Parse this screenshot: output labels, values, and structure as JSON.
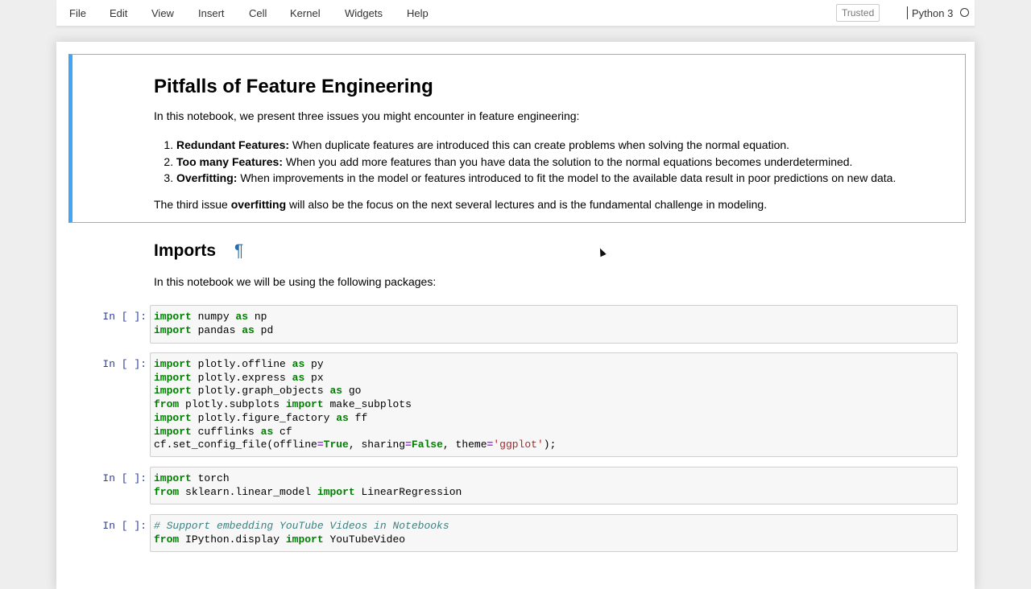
{
  "menubar": {
    "items": [
      "File",
      "Edit",
      "View",
      "Insert",
      "Cell",
      "Kernel",
      "Widgets",
      "Help"
    ],
    "trusted_label": "Trusted",
    "kernel_name": "Python 3"
  },
  "intro": {
    "title": "Pitfalls of Feature Engineering",
    "lead": "In this notebook, we present three issues you might encounter in feature engineering:",
    "issues": [
      {
        "term": "Redundant Features:",
        "text": " When duplicate features are introduced this can create problems when solving the normal equation."
      },
      {
        "term": "Too many Features:",
        "text": " When you add more features than you have data the solution to the normal equations becomes underdetermined."
      },
      {
        "term": "Overfitting:",
        "text": " When improvements in the model or features introduced to fit the model to the available data result in poor predictions on new data."
      }
    ],
    "closing_pre": "The third issue ",
    "closing_bold": "overfitting",
    "closing_post": " will also be the focus on the next several lectures and is the fundamental challenge in modeling."
  },
  "imports": {
    "heading": "Imports",
    "anchor": "¶",
    "subtitle": "In this notebook we will be using the following packages:"
  },
  "cells": [
    {
      "prompt": "In [ ]:",
      "lines": [
        [
          {
            "t": "import",
            "c": "kw"
          },
          {
            "t": " numpy ",
            "c": ""
          },
          {
            "t": "as",
            "c": "kw"
          },
          {
            "t": " np",
            "c": ""
          }
        ],
        [
          {
            "t": "import",
            "c": "kw"
          },
          {
            "t": " pandas ",
            "c": ""
          },
          {
            "t": "as",
            "c": "kw"
          },
          {
            "t": " pd",
            "c": ""
          }
        ]
      ]
    },
    {
      "prompt": "In [ ]:",
      "lines": [
        [
          {
            "t": "import",
            "c": "kw"
          },
          {
            "t": " plotly.offline ",
            "c": ""
          },
          {
            "t": "as",
            "c": "kw"
          },
          {
            "t": " py",
            "c": ""
          }
        ],
        [
          {
            "t": "import",
            "c": "kw"
          },
          {
            "t": " plotly.express ",
            "c": ""
          },
          {
            "t": "as",
            "c": "kw"
          },
          {
            "t": " px",
            "c": ""
          }
        ],
        [
          {
            "t": "import",
            "c": "kw"
          },
          {
            "t": " plotly.graph_objects ",
            "c": ""
          },
          {
            "t": "as",
            "c": "kw"
          },
          {
            "t": " go",
            "c": ""
          }
        ],
        [
          {
            "t": "from",
            "c": "kw"
          },
          {
            "t": " plotly.subplots ",
            "c": ""
          },
          {
            "t": "import",
            "c": "kw"
          },
          {
            "t": " make_subplots",
            "c": ""
          }
        ],
        [
          {
            "t": "import",
            "c": "kw"
          },
          {
            "t": " plotly.figure_factory ",
            "c": ""
          },
          {
            "t": "as",
            "c": "kw"
          },
          {
            "t": " ff",
            "c": ""
          }
        ],
        [
          {
            "t": "import",
            "c": "kw"
          },
          {
            "t": " cufflinks ",
            "c": ""
          },
          {
            "t": "as",
            "c": "kw"
          },
          {
            "t": " cf",
            "c": ""
          }
        ],
        [
          {
            "t": "cf.set_config_file(offline",
            "c": ""
          },
          {
            "t": "=",
            "c": "op"
          },
          {
            "t": "True",
            "c": "kw"
          },
          {
            "t": ", sharing",
            "c": ""
          },
          {
            "t": "=",
            "c": "op"
          },
          {
            "t": "False",
            "c": "kw"
          },
          {
            "t": ", theme",
            "c": ""
          },
          {
            "t": "=",
            "c": "op"
          },
          {
            "t": "'ggplot'",
            "c": "str"
          },
          {
            "t": ");",
            "c": ""
          }
        ]
      ]
    },
    {
      "prompt": "In [ ]:",
      "lines": [
        [
          {
            "t": "import",
            "c": "kw"
          },
          {
            "t": " torch",
            "c": ""
          }
        ],
        [
          {
            "t": "from",
            "c": "kw"
          },
          {
            "t": " sklearn.linear_model ",
            "c": ""
          },
          {
            "t": "import",
            "c": "kw"
          },
          {
            "t": " LinearRegression",
            "c": ""
          }
        ]
      ]
    },
    {
      "prompt": "In [ ]:",
      "lines": [
        [
          {
            "t": "# Support embedding YouTube Videos in Notebooks",
            "c": "cm"
          }
        ],
        [
          {
            "t": "from",
            "c": "kw"
          },
          {
            "t": " IPython.display ",
            "c": ""
          },
          {
            "t": "import",
            "c": "kw"
          },
          {
            "t": " YouTubeVideo",
            "c": ""
          }
        ]
      ]
    }
  ]
}
